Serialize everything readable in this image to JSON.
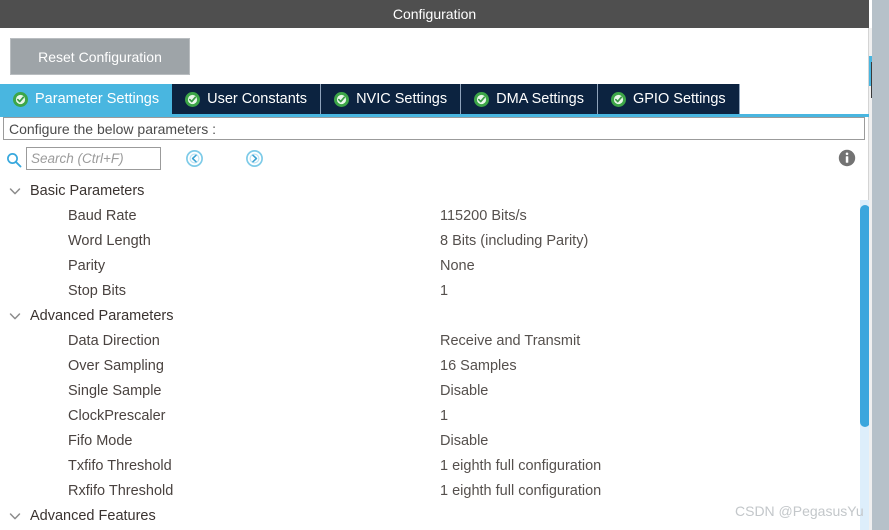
{
  "window": {
    "title": "Configuration"
  },
  "toolbar": {
    "reset_label": "Reset Configuration"
  },
  "tabs": [
    {
      "label": "Parameter Settings",
      "icon": "green-check-icon",
      "active": true
    },
    {
      "label": "User Constants",
      "icon": "green-check-icon",
      "active": false
    },
    {
      "label": "NVIC Settings",
      "icon": "green-check-icon",
      "active": false
    },
    {
      "label": "DMA Settings",
      "icon": "green-check-icon",
      "active": false
    },
    {
      "label": "GPIO Settings",
      "icon": "green-check-icon",
      "active": false
    }
  ],
  "infobar": {
    "text": "Configure the below parameters :"
  },
  "search": {
    "placeholder": "Search (Ctrl+F)",
    "value": "",
    "icon": "search-icon",
    "prev_icon": "nav-back-icon",
    "next_icon": "nav-forward-icon"
  },
  "help": {
    "icon": "info-icon"
  },
  "groups": [
    {
      "label": "Basic Parameters",
      "expanded": true,
      "chevron": "chevron-down-icon",
      "params": [
        {
          "name": "Baud Rate",
          "value": "115200 Bits/s"
        },
        {
          "name": "Word Length",
          "value": "8 Bits (including Parity)"
        },
        {
          "name": "Parity",
          "value": "None"
        },
        {
          "name": "Stop Bits",
          "value": "1"
        }
      ]
    },
    {
      "label": "Advanced Parameters",
      "expanded": true,
      "chevron": "chevron-down-icon",
      "params": [
        {
          "name": "Data Direction",
          "value": "Receive and Transmit"
        },
        {
          "name": "Over Sampling",
          "value": "16 Samples"
        },
        {
          "name": "Single Sample",
          "value": "Disable"
        },
        {
          "name": "ClockPrescaler",
          "value": "1"
        },
        {
          "name": "Fifo Mode",
          "value": "Disable"
        },
        {
          "name": "Txfifo Threshold",
          "value": "1 eighth full configuration"
        },
        {
          "name": "Rxfifo Threshold",
          "value": "1 eighth full configuration"
        }
      ]
    },
    {
      "label": "Advanced Features",
      "expanded": true,
      "chevron": "chevron-down-icon",
      "params": []
    }
  ],
  "watermark": {
    "text": "CSDN @PegasusYu"
  },
  "colors": {
    "titlebar": "#4f4f4f",
    "tab_active": "#49b6e0",
    "tab_inactive": "#0c2340",
    "check_green": "#3da648",
    "scrollbar_thumb": "#3ba6dd",
    "reset_button": "#9ea4a8"
  }
}
